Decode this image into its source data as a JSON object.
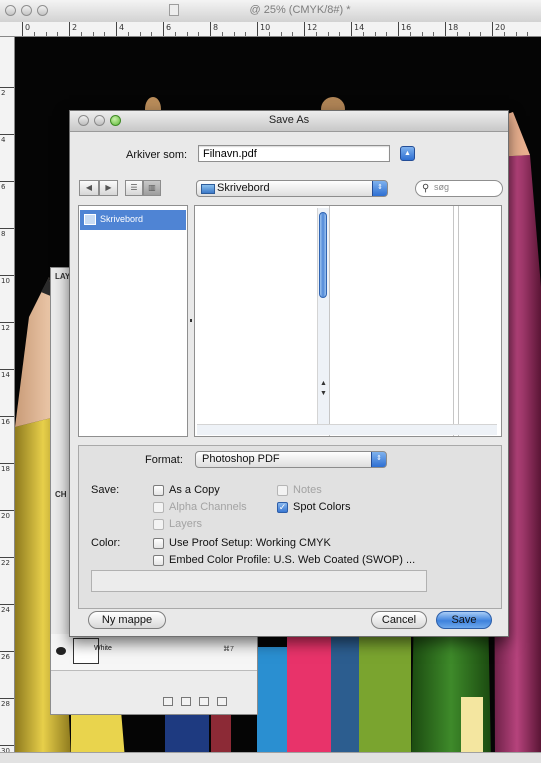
{
  "doc": {
    "title": "@ 25% (CMYK/8#) *",
    "ruler_top_labels": [
      "0",
      "2",
      "4",
      "6",
      "8",
      "10",
      "12",
      "14",
      "16",
      "18",
      "20"
    ],
    "ruler_left_labels": [
      "2",
      "4",
      "6",
      "8",
      "10",
      "12",
      "14",
      "16",
      "18",
      "20",
      "22",
      "24",
      "26",
      "28",
      "30"
    ],
    "status": ""
  },
  "colors": {
    "dialog_bg": "#e9e9e9",
    "accent_blue": "#3e82dd",
    "selection": "#4f84d4",
    "canvas_bg": "#050505",
    "pencils": [
      "#8c2f55",
      "#e83a64",
      "#2d6e1e",
      "#b79a37",
      "#2a8fd1",
      "#f2f2f2",
      "#f4e6a0",
      "#1e3a80",
      "#d8c84a"
    ]
  },
  "panel": {
    "tab_layers": "LAY",
    "tab_channels": "CH",
    "rows": [
      {
        "name": "White",
        "key": "⌘7"
      }
    ]
  },
  "dialog": {
    "title": "Save As",
    "save_as_label": "Arkiver som:",
    "filename": "Filnavn.pdf",
    "location": "Skrivebord",
    "search_placeholder": "søg",
    "sidebar_items": [
      "Skrivebord"
    ],
    "format_label": "Format:",
    "format_value": "Photoshop PDF",
    "save_label": "Save:",
    "options": {
      "as_copy": "As a Copy",
      "notes": "Notes",
      "alpha_channels": "Alpha Channels",
      "spot_colors": "Spot Colors",
      "layers": "Layers"
    },
    "color_label": "Color:",
    "use_proof": "Use Proof Setup:  Working CMYK",
    "embed_profile": "Embed Color Profile:  U.S. Web Coated (SWOP) ...",
    "new_folder": "Ny mappe",
    "cancel": "Cancel",
    "save": "Save"
  },
  "icons": [
    "back-arrow-icon",
    "forward-arrow-icon",
    "list-view-icon",
    "column-view-icon",
    "folder-icon",
    "search-icon",
    "expand-icon",
    "eye-icon"
  ]
}
